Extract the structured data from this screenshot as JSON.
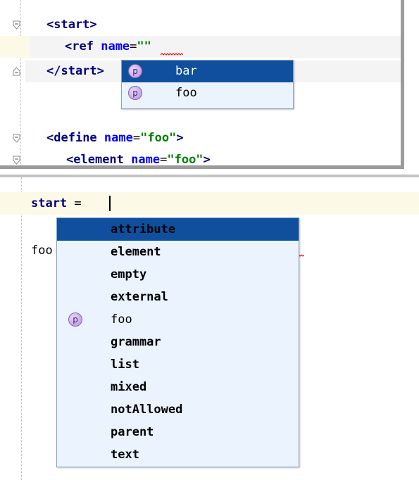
{
  "xml_editor": {
    "line1": {
      "open": "<start>"
    },
    "line2": {
      "lt": "<",
      "tag": "ref",
      "attr": "name",
      "eq": "=",
      "val": "\"\""
    },
    "line3": {
      "close": "</start>"
    },
    "line5": {
      "lt": "<",
      "tag": "define",
      "attr": "name",
      "eq": "=",
      "val": "\"foo\"",
      "gt": ">"
    },
    "line6": {
      "lt": "<",
      "tag": "element",
      "attr": "name",
      "eq": "=",
      "val": "\"foo\"",
      "gt": ">"
    },
    "completion": {
      "items": [
        {
          "icon": "p",
          "label": "bar"
        },
        {
          "icon": "p",
          "label": "foo"
        }
      ]
    }
  },
  "rnc_editor": {
    "line1": {
      "kw": "start",
      "op": " ="
    },
    "line3": {
      "partial": "foo"
    },
    "completion": {
      "items": [
        {
          "label": "attribute"
        },
        {
          "label": "element"
        },
        {
          "label": "empty"
        },
        {
          "label": "external"
        },
        {
          "icon": "p",
          "label": "foo"
        },
        {
          "label": "grammar"
        },
        {
          "label": "list"
        },
        {
          "label": "mixed"
        },
        {
          "label": "notAllowed"
        },
        {
          "label": "parent"
        },
        {
          "label": "text"
        }
      ]
    }
  },
  "colors": {
    "selection": "#0f4f9e",
    "popup_bg": "#ebf4fe",
    "tag": "#000080",
    "attr": "#0000ff",
    "string": "#008000"
  }
}
